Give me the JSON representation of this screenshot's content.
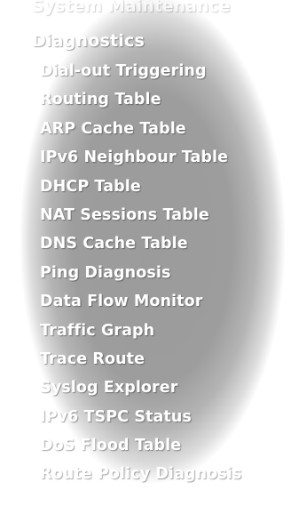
{
  "menu": {
    "parent_label": "System Maintenance",
    "section_title": "Diagnostics",
    "items": [
      {
        "label": "Dial-out Triggering"
      },
      {
        "label": "Routing Table"
      },
      {
        "label": "ARP Cache Table"
      },
      {
        "label": "IPv6 Neighbour Table"
      },
      {
        "label": "DHCP Table"
      },
      {
        "label": "NAT Sessions Table"
      },
      {
        "label": "DNS Cache Table"
      },
      {
        "label": "Ping Diagnosis"
      },
      {
        "label": "Data Flow Monitor"
      },
      {
        "label": "Traffic Graph"
      },
      {
        "label": "Trace Route"
      },
      {
        "label": "Syslog Explorer"
      },
      {
        "label": "IPv6 TSPC Status"
      },
      {
        "label": "DoS Flood Table"
      },
      {
        "label": "Route Policy Diagnosis"
      }
    ]
  },
  "colors": {
    "panel_gray": "#9d9d9d",
    "text": "#ffffff"
  }
}
